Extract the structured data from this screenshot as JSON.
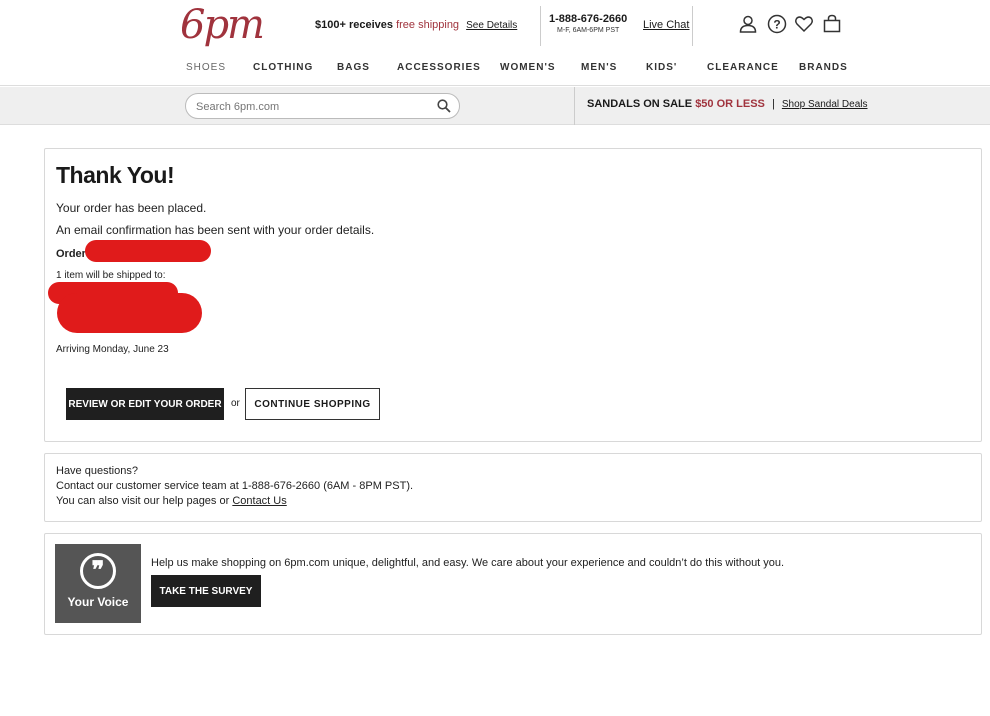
{
  "header": {
    "logo": "6pm",
    "promo": {
      "bold": "$100+ receives",
      "highlight": "free shipping",
      "link": "See Details"
    },
    "phone": "1-888-676-2660",
    "hours": "M-F, 6AM-6PM PST",
    "live_chat": "Live Chat",
    "icons": [
      "account-icon",
      "help-icon",
      "favorites-icon",
      "cart-icon"
    ]
  },
  "nav": [
    "SHOES",
    "CLOTHING",
    "BAGS",
    "ACCESSORIES",
    "WOMEN'S",
    "MEN'S",
    "KIDS'",
    "CLEARANCE",
    "BRANDS"
  ],
  "search": {
    "placeholder": "Search 6pm.com"
  },
  "sale_banner": {
    "lead": "SANDALS ON SALE",
    "highlight": "$50 OR LESS",
    "separator": "|",
    "link": "Shop Sandal Deals"
  },
  "confirmation": {
    "title": "Thank You!",
    "placed": "Your order has been placed.",
    "email": "An email confirmation has been sent with your order details.",
    "order_label": "Order",
    "shipped": "1 item will be shipped to:",
    "arriving": "Arriving Monday, June 23",
    "review_button": "REVIEW OR EDIT YOUR ORDER",
    "or": "or",
    "continue_button": "CONTINUE SHOPPING"
  },
  "questions": {
    "line1": "Have questions?",
    "line2": "Contact our customer service team at 1-888-676-2660 (6AM - 8PM PST).",
    "line3": "You can also visit our help pages or",
    "contact_link": "Contact Us"
  },
  "voice": {
    "badge_symbol": "❞",
    "badge_label": "Your Voice",
    "text": "Help us make shopping on 6pm.com unique, delightful, and easy. We care about your experience and couldn’t do this without you.",
    "button": "TAKE THE SURVEY"
  },
  "colors": {
    "brand": "#a0333d",
    "dark_button": "#1f1f1f",
    "redaction": "#e01b1b"
  }
}
